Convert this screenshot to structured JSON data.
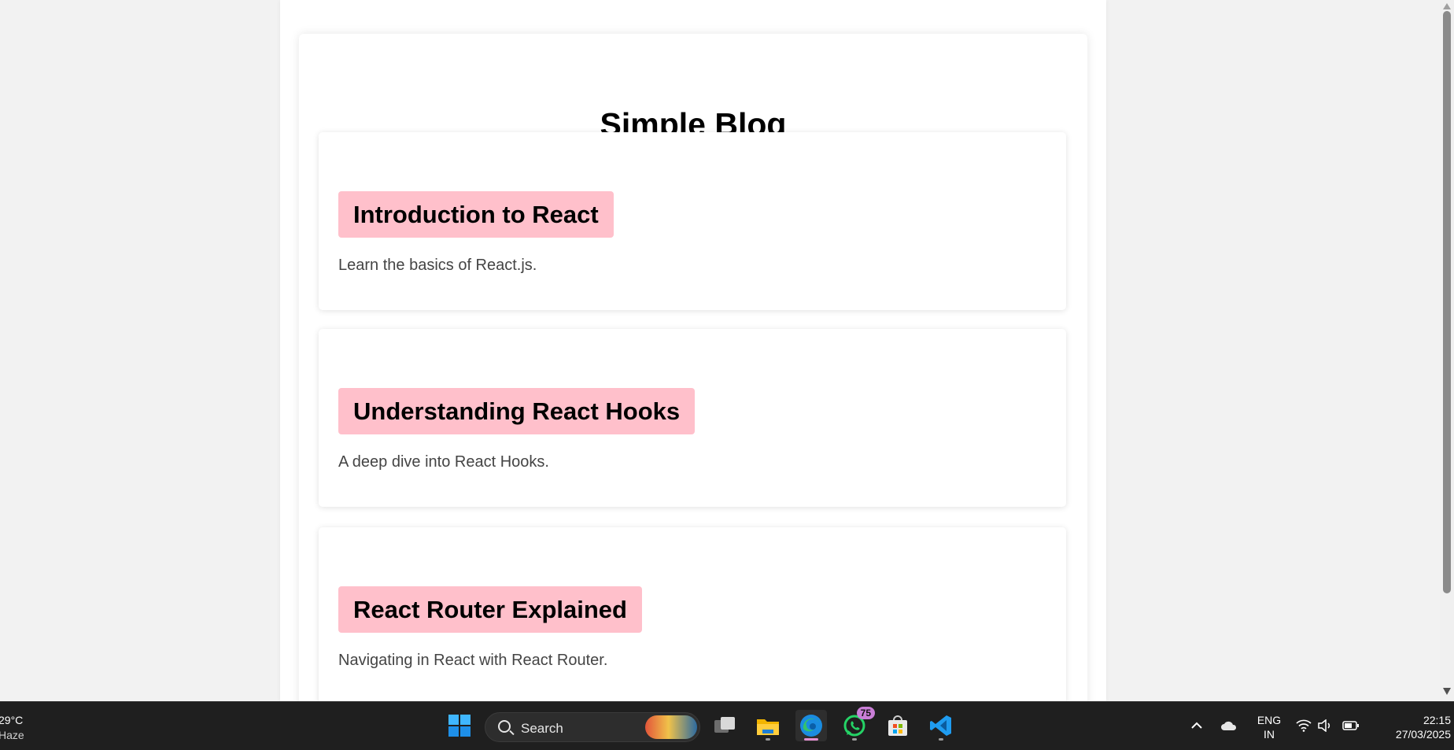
{
  "blog": {
    "title": "Simple Blog",
    "posts": [
      {
        "title": "Introduction to React",
        "excerpt": "Learn the basics of React.js."
      },
      {
        "title": "Understanding React Hooks",
        "excerpt": "A deep dive into React Hooks."
      },
      {
        "title": "React Router Explained",
        "excerpt": "Navigating in React with React Router."
      }
    ]
  },
  "colors": {
    "post_title_bg": "#ffc0cb",
    "page_bg": "#f2f2f2",
    "taskbar_bg": "#1f1f1f"
  },
  "taskbar": {
    "weather": {
      "temp": "29°C",
      "condition": "Haze"
    },
    "search_label": "Search",
    "apps": [
      "windows-start-icon",
      "task-view-icon",
      "file-explorer-icon",
      "edge-icon",
      "whatsapp-icon",
      "microsoft-store-icon",
      "vscode-icon"
    ],
    "whatsapp_badge": "75",
    "lang_line1": "ENG",
    "lang_line2": "IN",
    "time": "22:15",
    "date": "27/03/2025"
  }
}
